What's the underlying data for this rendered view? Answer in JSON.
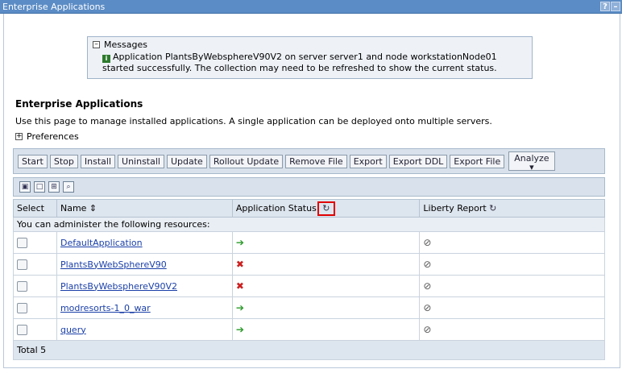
{
  "window": {
    "title": "Enterprise Applications",
    "help": "?",
    "minimize": "–"
  },
  "messages": {
    "header": "Messages",
    "collapse_glyph": "–",
    "info_glyph": "i",
    "text": "Application PlantsByWebsphereV90V2 on server server1 and node workstationNode01 started successfully. The collection may need to be refreshed to show the current status."
  },
  "page": {
    "title": "Enterprise Applications",
    "description": "Use this page to manage installed applications. A single application can be deployed onto multiple servers.",
    "preferences": "Preferences",
    "prefs_glyph": "+"
  },
  "toolbar": {
    "start": "Start",
    "stop": "Stop",
    "install": "Install",
    "uninstall": "Uninstall",
    "update": "Update",
    "rollout": "Rollout Update",
    "remove_file": "Remove File",
    "export": "Export",
    "export_ddl": "Export DDL",
    "export_file": "Export File",
    "analyze": "Analyze",
    "analyze_caret": "▾"
  },
  "icon_toolbar": [
    "select-all",
    "deselect-all",
    "show-filter",
    "clear-filter"
  ],
  "table": {
    "headers": {
      "select": "Select",
      "name": "Name",
      "sort_glyph": "⇕",
      "status": "Application Status",
      "liberty": "Liberty Report",
      "refresh_glyph": "↻"
    },
    "subheader": "You can administer the following resources:",
    "rows": [
      {
        "name": "DefaultApplication",
        "status": "➔",
        "liberty": "⊘"
      },
      {
        "name": "PlantsByWebSphereV90",
        "status": "✖",
        "liberty": "⊘"
      },
      {
        "name": "PlantsByWebsphereV90V2",
        "status": "✖",
        "liberty": "⊘"
      },
      {
        "name": "modresorts-1_0_war",
        "status": "➔",
        "liberty": "⊘"
      },
      {
        "name": "query",
        "status": "➔",
        "liberty": "⊘"
      }
    ],
    "total": "Total 5"
  },
  "colors": {
    "titlebar": "#5b8cc5",
    "highlight": "#e00000",
    "running": "#2a9a2a",
    "stopped": "#cc2020"
  }
}
